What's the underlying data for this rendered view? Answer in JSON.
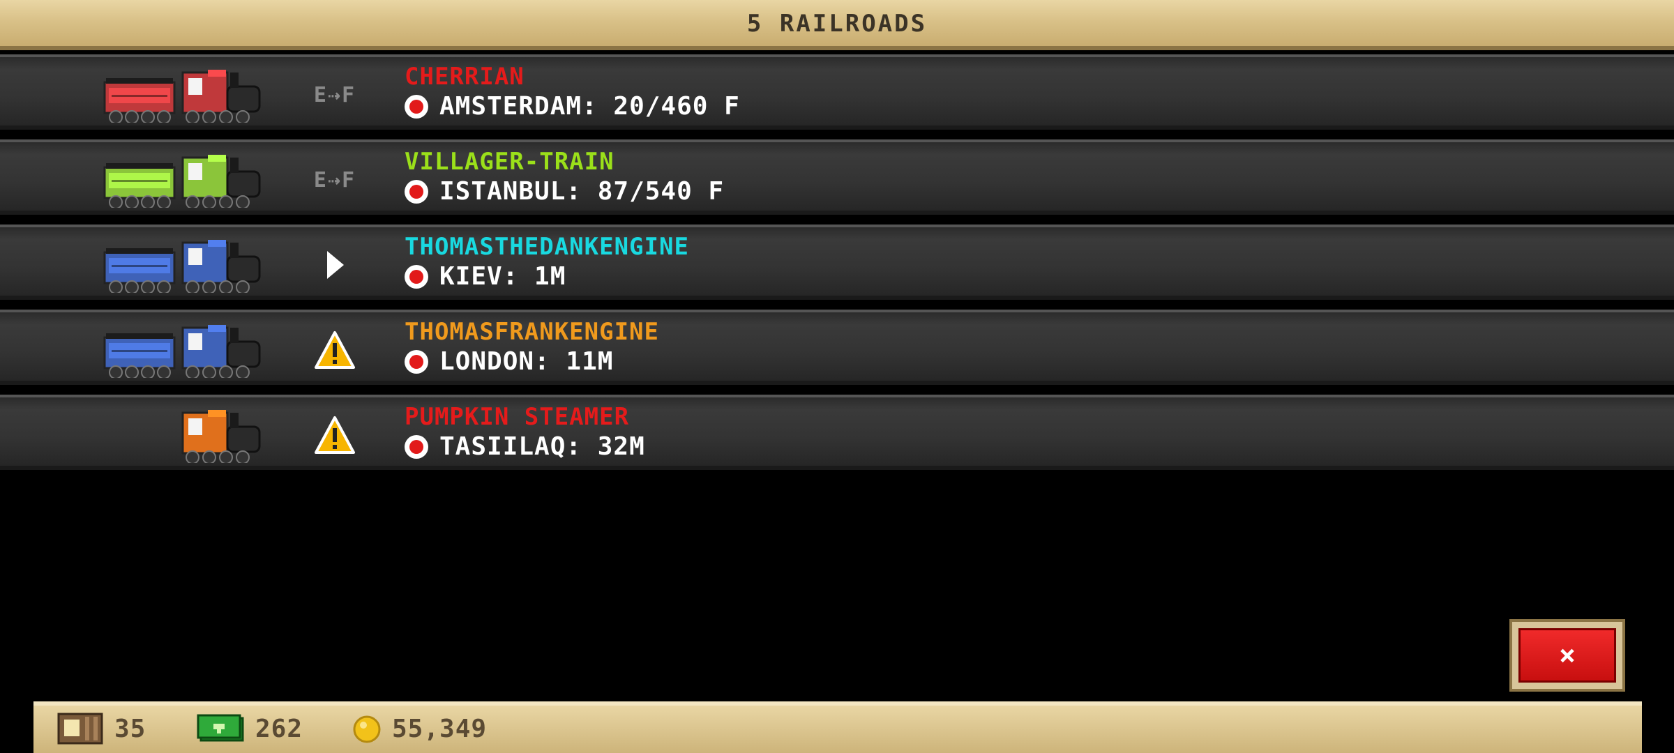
{
  "header": {
    "title": "5 RAILROADS"
  },
  "trains": [
    {
      "name": "CHERRIAN",
      "name_color": "#e51b1b",
      "destination": "AMSTERDAM: 20/460 F",
      "status": "E-F",
      "body_color": "#c0393b",
      "has_tender": true
    },
    {
      "name": "VILLAGER-TRAIN",
      "name_color": "#9be01a",
      "destination": "ISTANBUL: 87/540 F",
      "status": "E-F",
      "body_color": "#8bc53a",
      "has_tender": true
    },
    {
      "name": "THOMASTHEDANKENGINE",
      "name_color": "#19d9e0",
      "destination": "KIEV: 1M",
      "status": "play",
      "body_color": "#3f62b8",
      "has_tender": true
    },
    {
      "name": "THOMASFRANKENGINE",
      "name_color": "#f09a1d",
      "destination": "LONDON: 11M",
      "status": "warning",
      "body_color": "#3f62b8",
      "has_tender": true
    },
    {
      "name": "PUMPKIN STEAMER",
      "name_color": "#e51b1b",
      "destination": "TASIILAQ: 32M",
      "status": "warning",
      "body_color": "#e0701c",
      "has_tender": false
    }
  ],
  "status_labels": {
    "ef_text": "E⇢F"
  },
  "close_button": {
    "label": "×"
  },
  "footer": {
    "crates": "35",
    "cash": "262",
    "coins": "55,349"
  },
  "colors": {
    "accent_red": "#e21a1a",
    "panel_tan": "#d9c188"
  }
}
